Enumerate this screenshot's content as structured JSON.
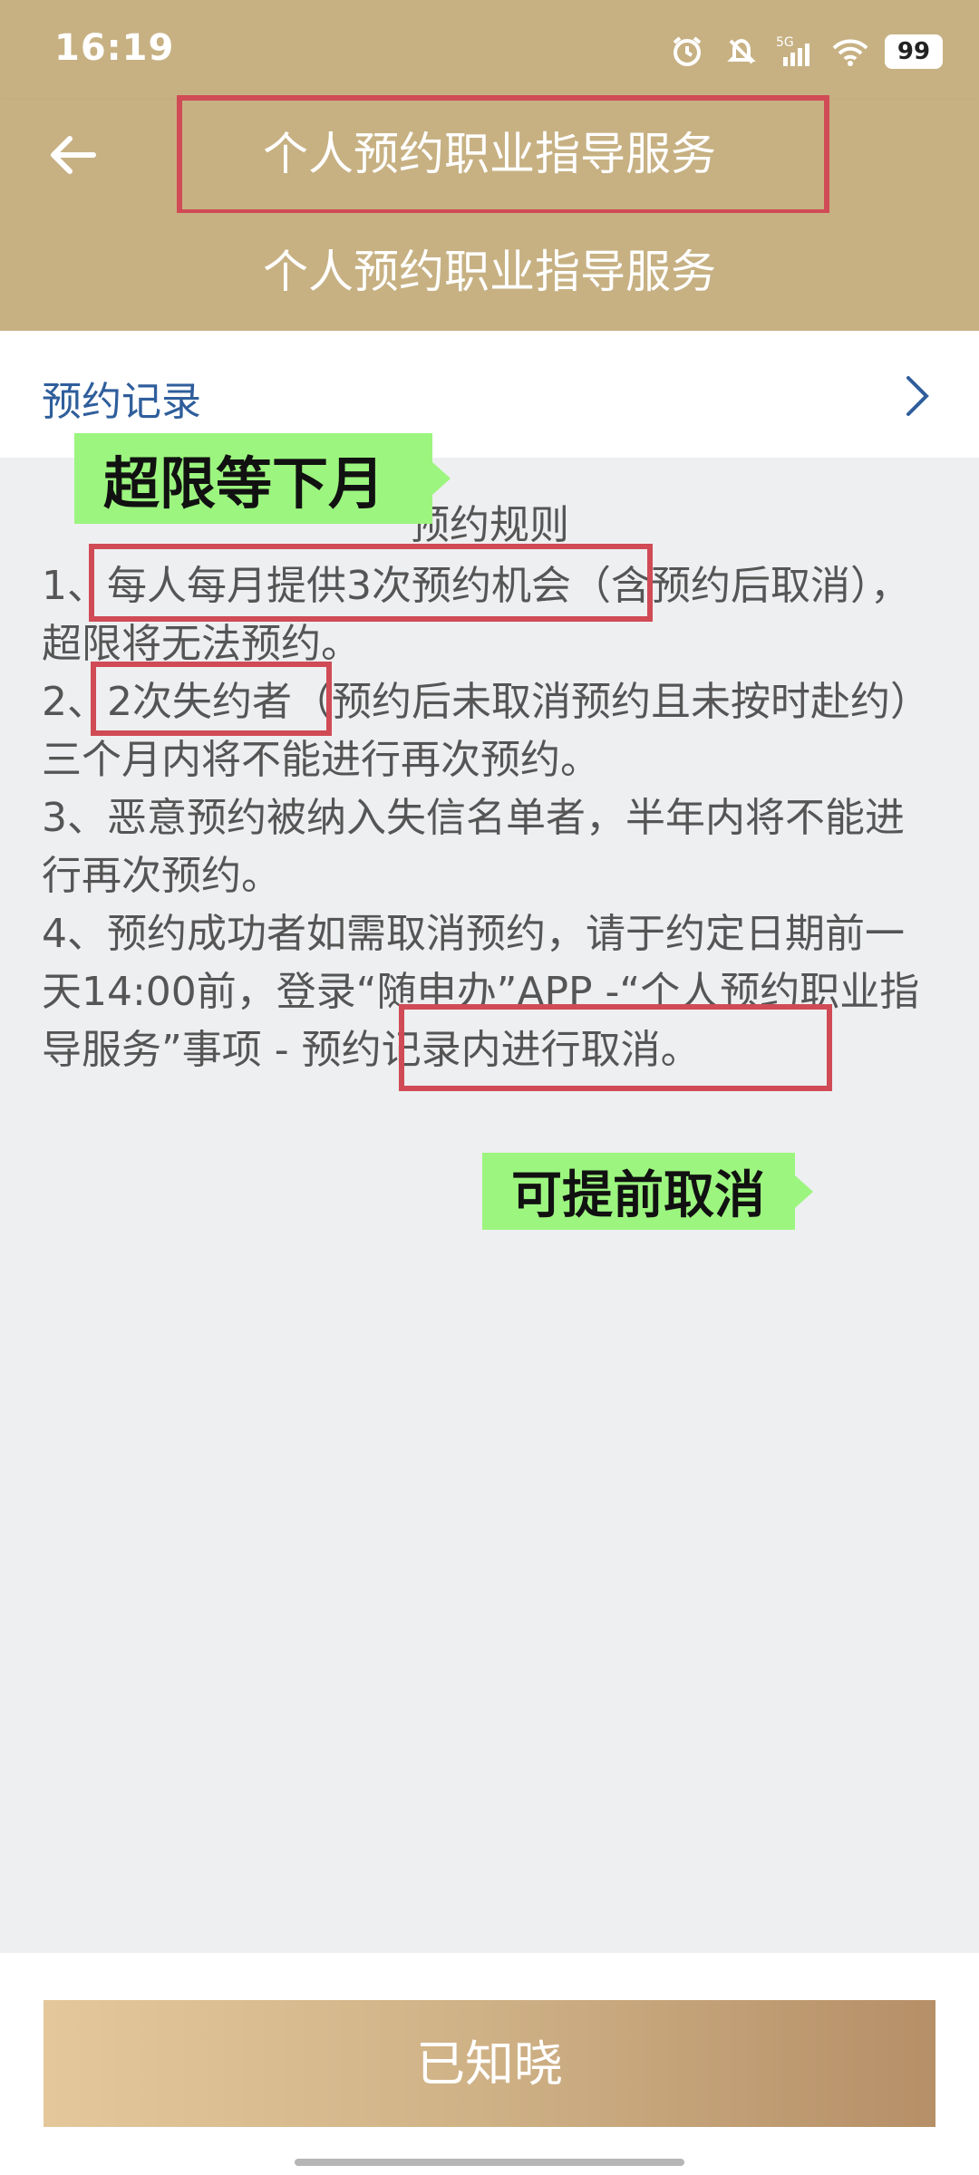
{
  "status": {
    "time": "16:19",
    "signal": "5G",
    "battery": "99"
  },
  "header": {
    "title": "个人预约职业指导服务",
    "sub_title": "个人预约职业指导服务"
  },
  "record": {
    "label": "预约记录"
  },
  "rules": {
    "title": "预约规则",
    "items": [
      "1、每人每月提供3次预约机会（含预约后取消），超限将无法预约。",
      "2、2次失约者（预约后未取消预约且未按时赴约）三个月内将不能进行再次预约。",
      "3、恶意预约被纳入失信名单者，半年内将不能进行再次预约。",
      "4、预约成功者如需取消预约，请于约定日期前一天14:00前，登录“随申办”APP -“个人预约职业指导服务”事项 - 预约记录内进行取消。"
    ]
  },
  "annotations": {
    "limit_label": "超限等下月",
    "cancel_label": "可提前取消"
  },
  "footer": {
    "button_label": "已知晓"
  },
  "colors": {
    "header_bg": "#c7b183",
    "accent_red": "#d04b55",
    "label_green": "#9cf57f",
    "link_blue": "#2f5e9b"
  }
}
